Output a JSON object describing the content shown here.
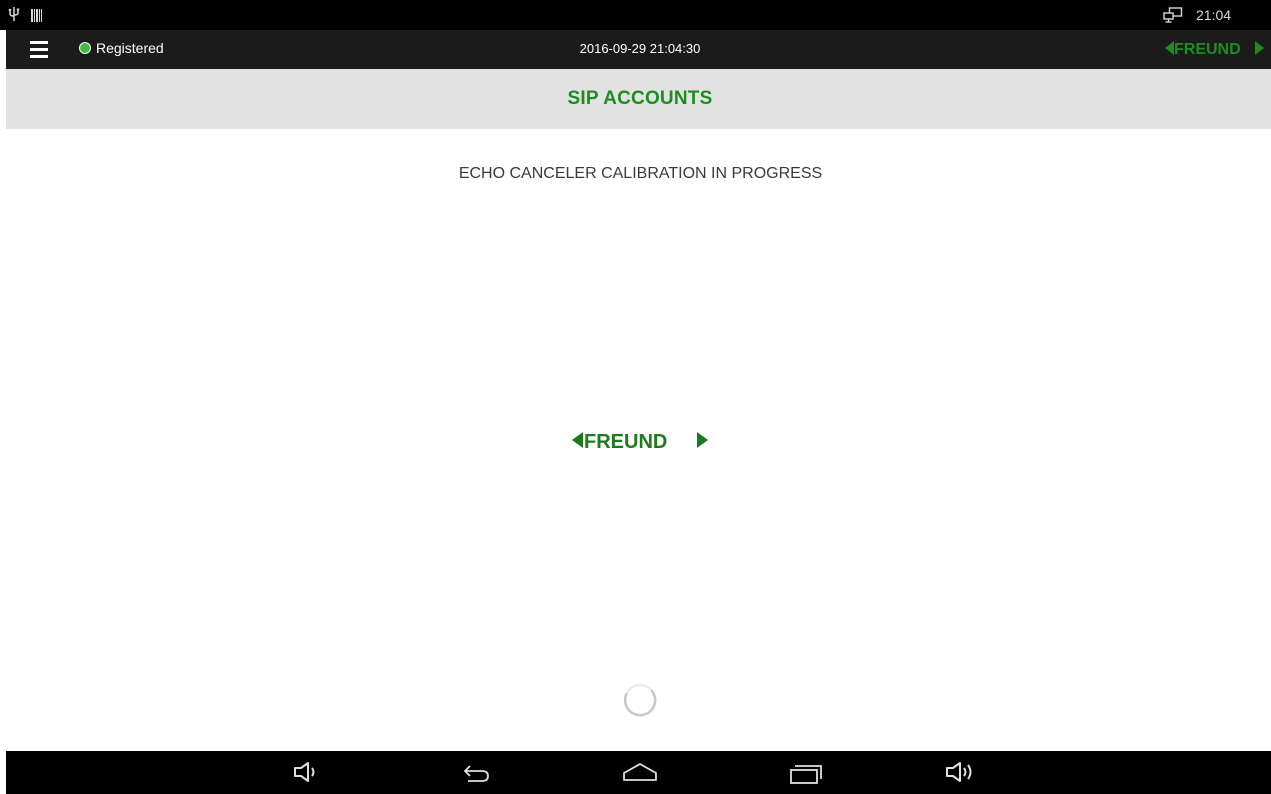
{
  "status_bar": {
    "time": "21:04",
    "icons": [
      "usb-icon",
      "barcode-icon",
      "screencast-icon"
    ]
  },
  "header": {
    "menu_icon": "hamburger-menu-icon",
    "registration_status": "Registered",
    "registration_color": "#3cbf3c",
    "datetime": "2016-09-29 21:04:30",
    "logo_text": "FREUND"
  },
  "title_bar": {
    "title": "SIP ACCOUNTS"
  },
  "main": {
    "status_message": "ECHO CANCELER CALIBRATION IN PROGRESS",
    "logo_text": "FREUND",
    "loading_icon": "loading-spinner-icon"
  },
  "nav_bar": {
    "buttons": [
      "volume-down-icon",
      "back-icon",
      "home-icon",
      "recent-apps-icon",
      "volume-up-icon"
    ]
  },
  "colors": {
    "brand_green": "#1f8c1f",
    "header_bg": "#1b1b1b",
    "title_bar_bg": "#e2e2e2",
    "system_bar_bg": "#000000"
  }
}
